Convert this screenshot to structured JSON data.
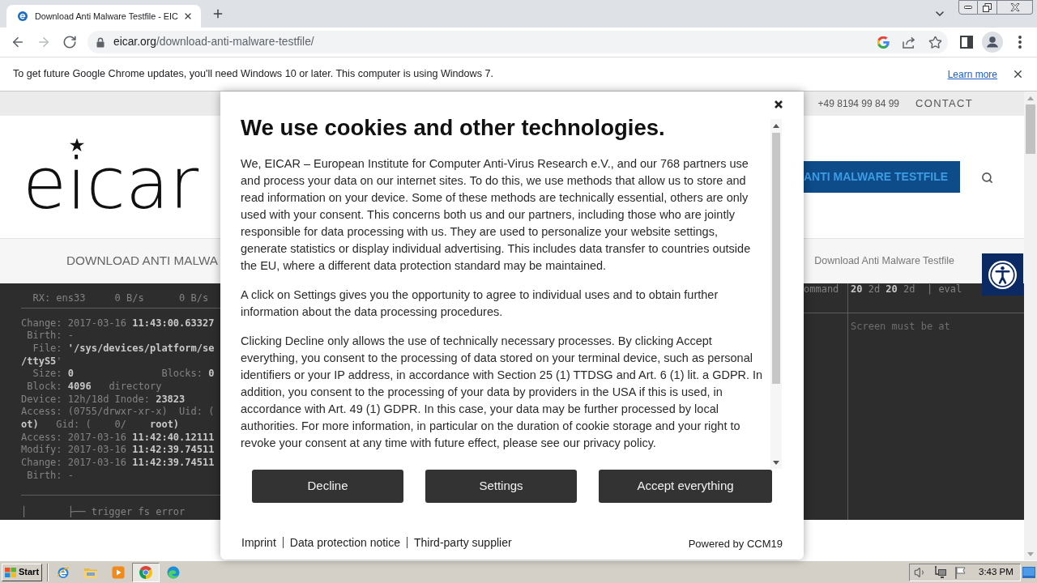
{
  "browser": {
    "tabs": [
      {
        "title": "Download Anti Malware Testfile - EIC",
        "selected": true
      }
    ],
    "nav_buttons": [
      {
        "kind": "back",
        "disabled": false
      },
      {
        "kind": "forward",
        "disabled": true
      },
      {
        "kind": "reload",
        "disabled": false
      }
    ],
    "address_bar": {
      "host": "eicar.org",
      "path": "/download-anti-malware-testfile/"
    },
    "info_bar": {
      "message": "To get future Google Chrome updates, you'll need Windows 10 or later. This computer is using Windows 7.",
      "link": "Learn more"
    }
  },
  "site": {
    "top_bar": {
      "phone": "+49 8194 99 84 99",
      "contact": "CONTACT"
    },
    "header": {
      "logo": "eicar",
      "button": "ANTI MALWARE TESTFILE"
    },
    "nav": {
      "menu_item": "DOWNLOAD ANTI MALWA",
      "breadcrumb": "Download Anti Malware Testfile"
    },
    "terminal": {
      "left_blocks": [
        [
          "  RX: ens33     0 B/s      0 B/s"
        ],
        [
          "Change: 2017-03-16 **11:43:00.63327**",
          " Birth: -",
          "  File: **'/sys/devices/platform/se**",
          "**/ttyS5**'",
          "  Size: **0**               Blocks: **0**",
          " Block: **4096**   directory",
          "Device: 12h/18d Inode: **23823**",
          "Access: (0755/drwxr-xr-x)  Uid: (",
          "**ot)**   Gid: (    0/    **root)**",
          "Access: 2017-03-16 **11:42:40.12111**",
          "Modify: 2017-03-16 **11:42:39.74511**",
          "Change: 2017-03-16 **11:42:39.74511**",
          " Birth: -"
        ],
        [
          "│       ├── trigger fs error"
        ]
      ],
      "right_header": [
        "ommand",
        "**20** 2d **20** 2d  | eval"
      ],
      "right_lines": [
        "Screen must be at"
      ]
    }
  },
  "cookie_dialog": {
    "title": "We use cookies and other technologies.",
    "paragraphs": [
      "We, EICAR – European Institute for Computer Anti-Virus Research e.V., and our 768 partners use and process your data on our internet sites. To do this, we use methods that allow us to store and read information on your device. Some of these methods are technically essential, others are only used with your consent. This concerns both us and our partners, including those who are jointly responsible for data processing with us. They are used to personalize your website settings, generate statistics or display individual advertising. This includes data transfer to countries outside the EU, where a different data protection standard may be maintained.",
      "A click on Settings gives you the opportunity to agree to individual uses and to obtain further information about the data processing procedures.",
      "Clicking Decline only allows the use of technically necessary processes. By clicking Accept everything, you consent to the processing of data stored on your terminal device, such as personal identifiers or your IP address, in accordance with Section 25 (1) TTDSG and Art. 6 (1) lit. a GDPR. In addition, you consent to the processing of your data by providers in the USA if this is used, in accordance with Art. 49 (1) GDPR. In this case, your data may be further processed by local authorities. For more information, in particular on the duration of cookie storage and your right to revoke your consent at any time with future effect, please see our privacy policy."
    ],
    "buttons": [
      "Decline",
      "Settings",
      "Accept everything"
    ],
    "footer_links": [
      "Imprint",
      "Data protection notice",
      "Third-party supplier"
    ],
    "powered_by": "Powered by CCM19"
  },
  "taskbar": {
    "start": "Start",
    "apps": [
      {
        "kind": "ie",
        "selected": false
      },
      {
        "kind": "explorer",
        "selected": false
      },
      {
        "kind": "media",
        "selected": false
      },
      {
        "kind": "chrome",
        "selected": true
      },
      {
        "kind": "edge",
        "selected": false
      }
    ],
    "clock": "3:43 PM"
  }
}
